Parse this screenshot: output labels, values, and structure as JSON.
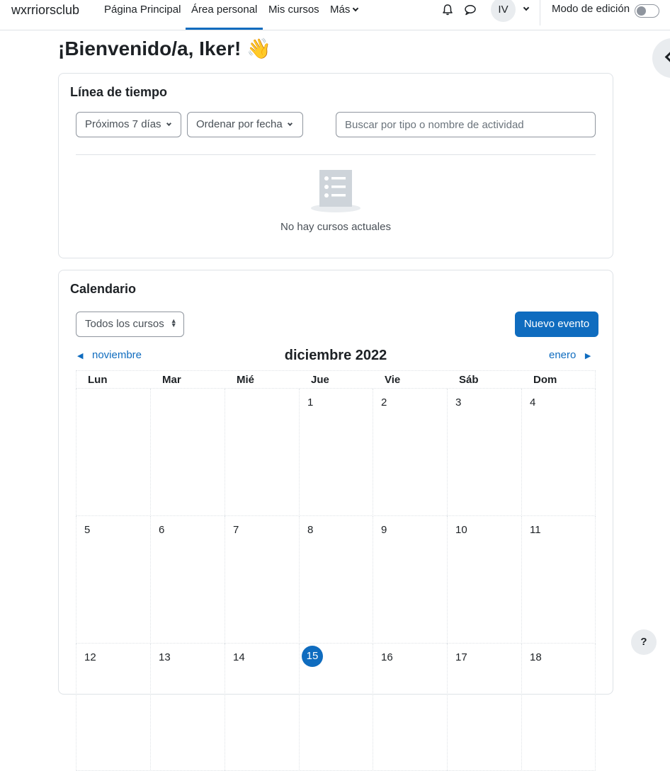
{
  "navbar": {
    "brand": "wxrriorsclub",
    "items": [
      {
        "label": "Página Principal"
      },
      {
        "label": "Área personal"
      },
      {
        "label": "Mis cursos"
      },
      {
        "label": "Más"
      }
    ],
    "avatar_initials": "IV",
    "edit_mode_label": "Modo de edición"
  },
  "page": {
    "title": "¡Bienvenido/a, Iker! 👋"
  },
  "timeline": {
    "title": "Línea de tiempo",
    "filter_label": "Próximos 7 días",
    "sort_label": "Ordenar por fecha",
    "search_placeholder": "Buscar por tipo o nombre de actividad",
    "empty_message": "No hay cursos actuales"
  },
  "calendar": {
    "title": "Calendario",
    "course_filter": "Todos los cursos",
    "new_event_label": "Nuevo evento",
    "prev_month": "noviembre",
    "next_month": "enero",
    "month_title": "diciembre 2022",
    "weekdays": [
      "Lun",
      "Mar",
      "Mié",
      "Jue",
      "Vie",
      "Sáb",
      "Dom"
    ],
    "weeks": [
      [
        "",
        "",
        "",
        "1",
        "2",
        "3",
        "4"
      ],
      [
        "5",
        "6",
        "7",
        "8",
        "9",
        "10",
        "11"
      ],
      [
        "12",
        "13",
        "14",
        "15",
        "16",
        "17",
        "18"
      ]
    ],
    "today": "15"
  },
  "help_label": "?",
  "colors": {
    "accent": "#0f6cbf",
    "border": "#dee2e6",
    "text": "#1d2125"
  }
}
